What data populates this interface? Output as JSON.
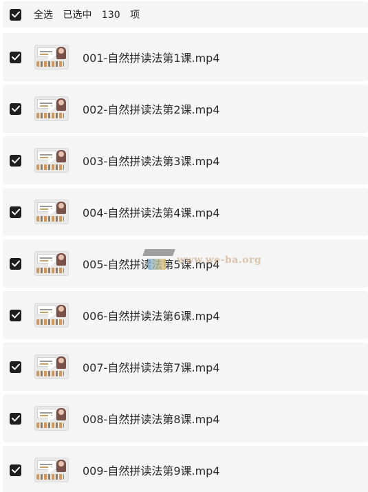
{
  "select_all": {
    "checked": true,
    "label": "全选",
    "selected_prefix": "已选中",
    "selected_count": "130",
    "selected_suffix": "项"
  },
  "files": [
    {
      "name": "001-自然拼读法第1课.mp4",
      "checked": true
    },
    {
      "name": "002-自然拼读法第2课.mp4",
      "checked": true
    },
    {
      "name": "003-自然拼读法第3课.mp4",
      "checked": true
    },
    {
      "name": "004-自然拼读法第4课.mp4",
      "checked": true
    },
    {
      "name": "005-自然拼读法第5课.mp4",
      "checked": true
    },
    {
      "name": "006-自然拼读法第6课.mp4",
      "checked": true
    },
    {
      "name": "007-自然拼读法第7课.mp4",
      "checked": true
    },
    {
      "name": "008-自然拼读法第8课.mp4",
      "checked": true
    },
    {
      "name": "009-自然拼读法第9课.mp4",
      "checked": true
    }
  ],
  "watermark": {
    "text": "www.we-ba.org"
  },
  "colors": {
    "checkbox": "#1e1e1e",
    "row_bg": "#f5f5f5",
    "text": "#2b2b2b"
  },
  "icons": {
    "checkbox": "checkmark-icon",
    "thumbnail": "video-thumbnail",
    "play": "play-icon"
  }
}
